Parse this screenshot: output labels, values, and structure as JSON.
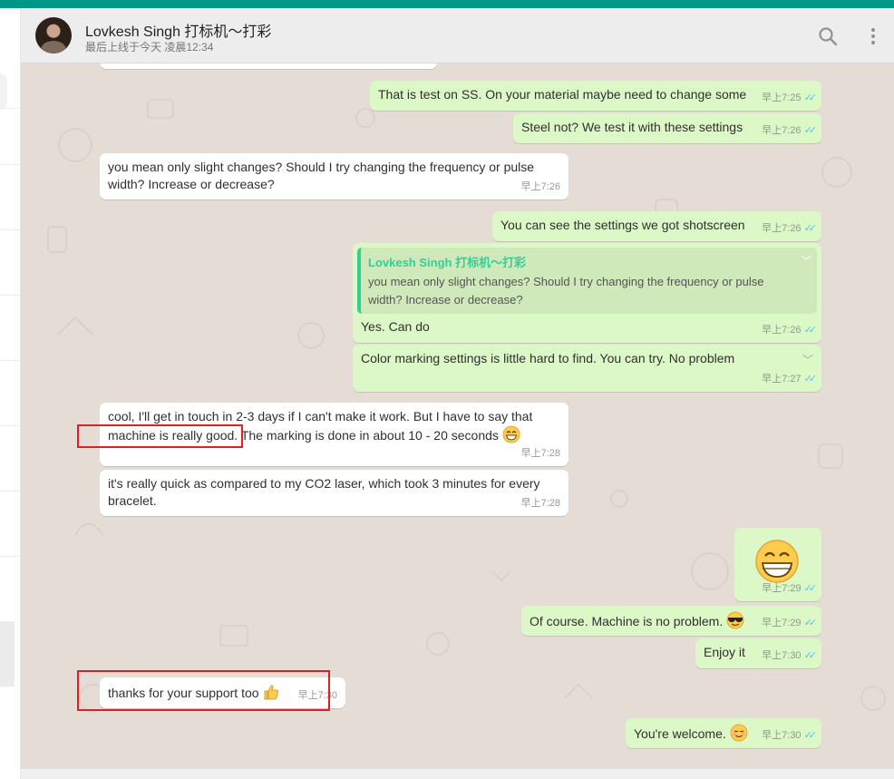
{
  "header": {
    "contact_name": "Lovkesh Singh 打标机～打彩",
    "status": "最后上线于今天 凌晨12:34",
    "search_icon": "search-icon",
    "menu_icon": "more-vertical-icon"
  },
  "colors": {
    "brand": "#009688",
    "chat_background": "#e5ddd5",
    "incoming": "#ffffff",
    "outgoing": "#dcf8c6",
    "read_tick": "#4fc3f7",
    "highlight_box": "#e02020"
  },
  "messages": [
    {
      "text": "That is test on SS. On your material maybe need to change some",
      "time": "早上7:25"
    },
    {
      "text": "Steel not? We test it with these settings",
      "time": "早上7:26"
    },
    {
      "text": "you mean only slight changes? Should I try changing the frequency or pulse width? Increase or decrease?",
      "time": "早上7:26"
    },
    {
      "text": "You can see the settings we got shotscreen",
      "time": "早上7:26"
    },
    {
      "quote_name": "Lovkesh Singh 打标机～打彩",
      "quote_text": "you mean only slight changes? Should I try changing the frequency or pulse width? Increase or decrease?",
      "text": "Yes. Can do",
      "time": "早上7:26"
    },
    {
      "text": "Color marking settings is little hard to find. You can try. No problem",
      "time": "早上7:27"
    },
    {
      "text_part1": "cool, I'll get in touch in 2-3 days if I can't make it work. But I have to say that",
      "text_part2": "machine is really good.",
      "text_part3": " The marking is done in about 10 - 20 seconds",
      "time": "早上7:28"
    },
    {
      "text": "it's really quick as compared to my CO2 laser, which took 3 minutes for every bracelet.",
      "time": "早上7:28"
    },
    {
      "text": "",
      "time": "早上7:29"
    },
    {
      "text": "Of course. Machine is no problem.",
      "time": "早上7:29"
    },
    {
      "text": "Enjoy it",
      "time": "早上7:30"
    },
    {
      "text": "thanks for your support too",
      "time": "早上7:30"
    },
    {
      "text": "You're welcome.",
      "time": "早上7:30"
    }
  ]
}
